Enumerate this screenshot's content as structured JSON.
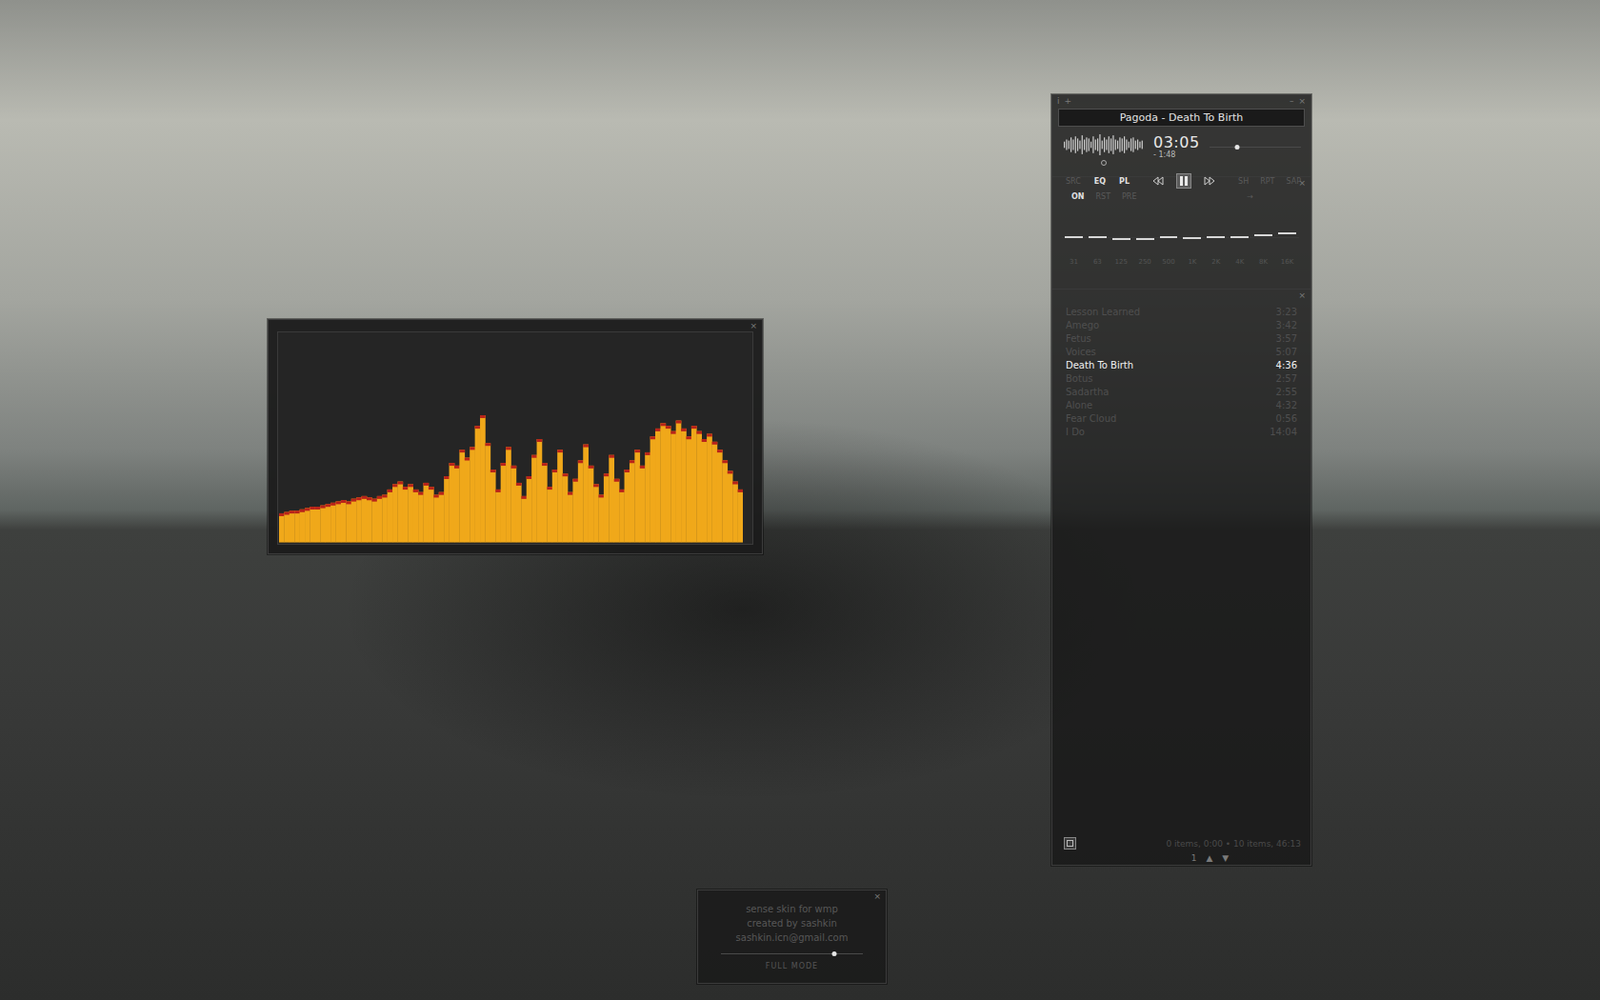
{
  "visualizer": {
    "close": "×",
    "spectrum": [
      22,
      23,
      24,
      24,
      25,
      26,
      27,
      27,
      28,
      29,
      30,
      31,
      32,
      31,
      33,
      34,
      35,
      34,
      33,
      35,
      36,
      40,
      44,
      46,
      42,
      44,
      40,
      38,
      45,
      42,
      36,
      38,
      50,
      60,
      58,
      70,
      64,
      72,
      88,
      96,
      75,
      55,
      40,
      60,
      72,
      58,
      45,
      35,
      50,
      66,
      78,
      60,
      42,
      55,
      70,
      52,
      38,
      48,
      62,
      74,
      58,
      44,
      36,
      52,
      66,
      48,
      40,
      55,
      62,
      70,
      58,
      68,
      80,
      86,
      90,
      88,
      84,
      92,
      86,
      80,
      88,
      84,
      78,
      82,
      76,
      70,
      62,
      54,
      46,
      40
    ]
  },
  "player": {
    "corner_icons": [
      "i",
      "+"
    ],
    "window_buttons": [
      "–",
      "×"
    ],
    "title": "Pagoda - Death To Birth",
    "time": "03:05",
    "remaining": "- 1:48",
    "seek": {
      "level": 0.3
    },
    "waveform": [
      0.3,
      0.5,
      0.4,
      0.7,
      0.5,
      0.8,
      0.6,
      0.4,
      0.9,
      0.5,
      0.7,
      0.6,
      0.3,
      0.8,
      0.5,
      0.6,
      1.0,
      0.4,
      0.7,
      0.5,
      0.8,
      0.6,
      0.9,
      0.5,
      0.4,
      0.7,
      0.6,
      0.8,
      0.5,
      0.3,
      0.6,
      0.7,
      0.4,
      0.5,
      0.3,
      0.4
    ],
    "left_buttons": [
      {
        "label": "SRC",
        "selected": false
      },
      {
        "label": "EQ",
        "selected": true
      },
      {
        "label": "PL",
        "selected": true
      }
    ],
    "right_buttons": [
      {
        "label": "SH",
        "selected": false
      },
      {
        "label": "RPT",
        "selected": false
      },
      {
        "label": "SAP",
        "selected": false
      }
    ]
  },
  "equalizer": {
    "close": "×",
    "buttons": [
      {
        "label": "ON",
        "selected": true
      },
      {
        "label": "RST",
        "selected": false
      },
      {
        "label": "PRE",
        "selected": false
      }
    ],
    "arrow": "→",
    "bands": [
      {
        "label": "31",
        "level": 0.5
      },
      {
        "label": "63",
        "level": 0.5
      },
      {
        "label": "125",
        "level": 0.44
      },
      {
        "label": "250",
        "level": 0.42
      },
      {
        "label": "500",
        "level": 0.5
      },
      {
        "label": "1K",
        "level": 0.46
      },
      {
        "label": "2K",
        "level": 0.5
      },
      {
        "label": "4K",
        "level": 0.5
      },
      {
        "label": "8K",
        "level": 0.58
      },
      {
        "label": "16K",
        "level": 0.62
      }
    ]
  },
  "playlist": {
    "close": "×",
    "items": [
      {
        "title": "Lesson Learned",
        "duration": "3:23",
        "selected": false
      },
      {
        "title": "Amego",
        "duration": "3:42",
        "selected": false
      },
      {
        "title": "Fetus",
        "duration": "3:57",
        "selected": false
      },
      {
        "title": "Voices",
        "duration": "5:07",
        "selected": false
      },
      {
        "title": "Death To Birth",
        "duration": "4:36",
        "selected": true
      },
      {
        "title": "Botus",
        "duration": "2:57",
        "selected": false
      },
      {
        "title": "Sadartha",
        "duration": "2:55",
        "selected": false
      },
      {
        "title": "Alone",
        "duration": "4:32",
        "selected": false
      },
      {
        "title": "Fear Cloud",
        "duration": "0:56",
        "selected": false
      },
      {
        "title": "I Do",
        "duration": "14:04",
        "selected": false
      }
    ],
    "status": "0 items, 0:00 • 10 items, 46:13",
    "nav": [
      "1",
      "▲",
      "▼"
    ]
  },
  "info": {
    "close": "×",
    "lines": [
      "sense skin for wmp",
      "created by sashkin",
      "sashkin.icn@gmail.com"
    ],
    "slider": {
      "level": 0.8
    },
    "mode": "FULL MODE"
  }
}
